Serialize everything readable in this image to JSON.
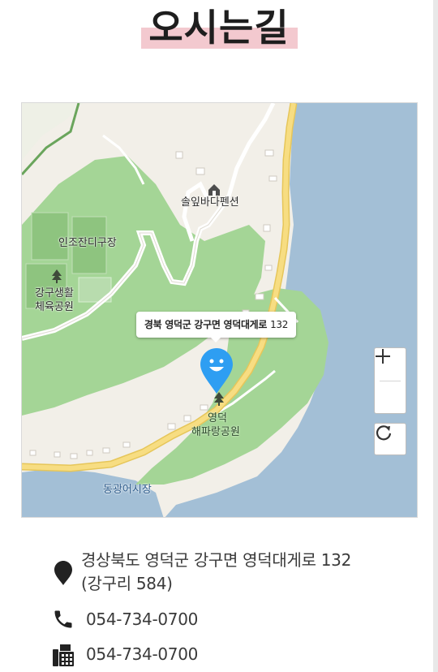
{
  "title": "오시는길",
  "map": {
    "places": {
      "pension": "솔잎바다펜션",
      "turf_field": "인조잔디구장",
      "sports_park_1": "강구생활",
      "sports_park_2": "체육공원",
      "park_1": "영덕",
      "park_2": "해파랑공원",
      "market": "동광어시장"
    },
    "tooltip": {
      "address": "경북 영덕군 강구면 영덕대게로",
      "number": "132"
    },
    "controls": {
      "zoom_in": "+",
      "zoom_out": "−"
    },
    "colors": {
      "sea": "#a3bfd6",
      "park": "#a4d596",
      "land": "#f2efe8",
      "road": "#f2d778",
      "pin": "#2e9ef2"
    }
  },
  "contact": {
    "address_line1": "경상북도 영덕군 강구면 영덕대게로 132",
    "address_line2": "(강구리 584)",
    "phone": "054-734-0700",
    "fax": "054-734-0700",
    "icons": [
      "location-pin-icon",
      "phone-icon",
      "fax-icon"
    ]
  }
}
